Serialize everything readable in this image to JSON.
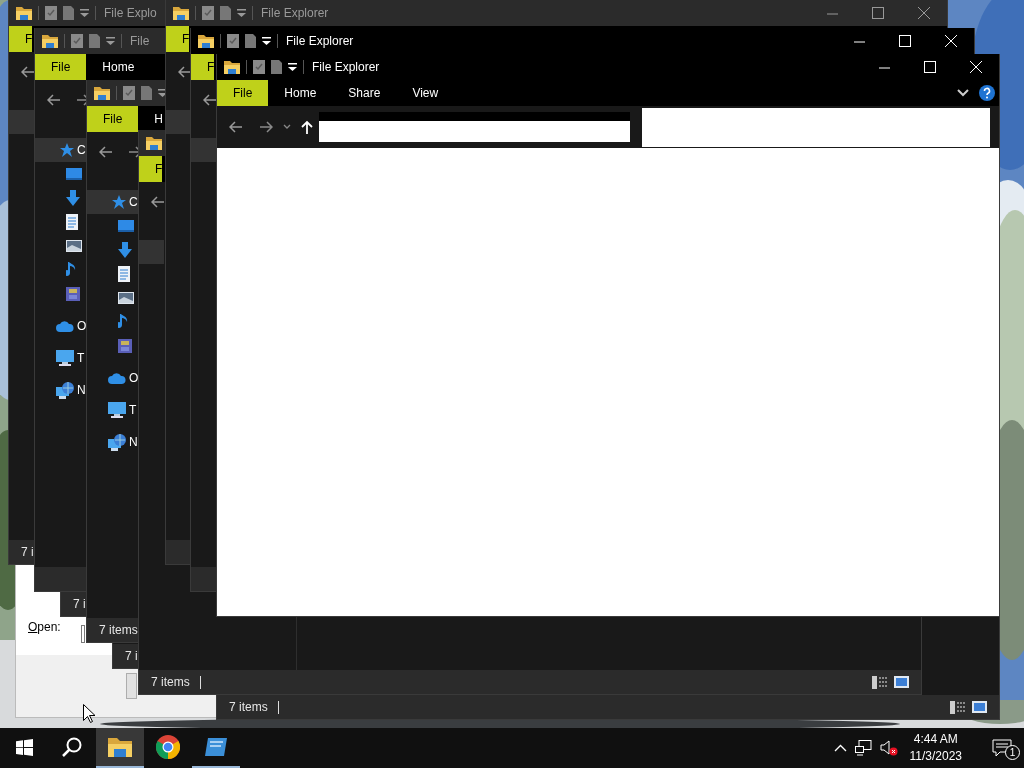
{
  "run_dialog": {
    "label": "Open:"
  },
  "windows": [
    {
      "kind": "explorer",
      "titlebar": {
        "title": "File Explo",
        "active": false
      },
      "ribbon_tabs": [
        {
          "label": "F",
          "selected": true
        }
      ],
      "nav": true,
      "sidebar": [
        {
          "kind": "quick",
          "selected": true
        }
      ],
      "status": "7 i"
    },
    {
      "kind": "explorer",
      "titlebar": {
        "title": "File",
        "active": false
      },
      "ribbon_tabs": [
        {
          "label": "File",
          "selected": true
        },
        {
          "label": "Home",
          "selected": false
        }
      ],
      "nav": true,
      "sidebar": [
        {
          "kind": "quick",
          "label": "C",
          "selected": true
        },
        {
          "kind": "desktop",
          "selected": false
        },
        {
          "kind": "downloads",
          "selected": false
        },
        {
          "kind": "documents",
          "selected": false
        },
        {
          "kind": "pictures",
          "selected": false
        },
        {
          "kind": "music",
          "selected": false
        },
        {
          "kind": "videos",
          "selected": false
        },
        {
          "kind": "cloud",
          "label": "O",
          "selected": false
        },
        {
          "kind": "pc",
          "label": "T",
          "selected": false
        },
        {
          "kind": "network",
          "label": "N",
          "selected": false
        }
      ]
    },
    {
      "kind": "explorer",
      "status": "7 i"
    },
    {
      "kind": "explorer",
      "titlebar": {
        "active": false
      },
      "ribbon_tabs": [
        {
          "label": "File",
          "selected": true
        },
        {
          "label": "H",
          "selected": false
        }
      ],
      "nav": true,
      "sidebar": [
        {
          "kind": "quick",
          "label": "C",
          "selected": true
        },
        {
          "kind": "desktop",
          "selected": false
        },
        {
          "kind": "downloads",
          "selected": false
        },
        {
          "kind": "documents",
          "selected": false
        },
        {
          "kind": "pictures",
          "selected": false
        },
        {
          "kind": "music",
          "selected": false
        },
        {
          "kind": "videos",
          "selected": false
        },
        {
          "kind": "cloud",
          "label": "O",
          "selected": false
        },
        {
          "kind": "pc",
          "label": "T",
          "selected": false
        },
        {
          "kind": "network",
          "label": "N",
          "selected": false
        }
      ],
      "status": "7 items"
    },
    {
      "kind": "explorer",
      "status": "7 i"
    },
    {
      "kind": "explorer",
      "status": "7 items",
      "view_buttons": true
    },
    {
      "kind": "explorer",
      "titlebar": {
        "active": false
      },
      "ribbon_tabs": [
        {
          "label": "F",
          "selected": true
        }
      ],
      "nav": true,
      "sidebar": [
        {
          "kind": "quick",
          "selected": true
        }
      ],
      "status": "7 items",
      "view_buttons": true
    },
    {
      "kind": "explorer",
      "titlebar": {
        "title": "File Explorer",
        "active": false,
        "controls": true
      },
      "ribbon_tabs": [
        {
          "label": "F",
          "selected": true
        }
      ],
      "nav": true,
      "sidebar": [
        {
          "kind": "quick",
          "selected": true
        }
      ]
    },
    {
      "kind": "explorer",
      "titlebar": {
        "title": "File Explorer",
        "active": true,
        "controls": true
      },
      "ribbon_tabs": [
        {
          "label": "F",
          "selected": true
        }
      ],
      "nav": true,
      "sidebar": [
        {
          "kind": "quick",
          "selected": true
        }
      ]
    },
    {
      "kind": "front",
      "titlebar": {
        "title": "File Explorer",
        "active": true,
        "controls": true
      },
      "ribbon_tabs": [
        {
          "label": "File",
          "selected": true
        },
        {
          "label": "Home",
          "selected": false
        },
        {
          "label": "Share",
          "selected": false
        },
        {
          "label": "View",
          "selected": false
        }
      ],
      "nav": true
    }
  ],
  "taskbar": {
    "apps": [
      {
        "kind": "start"
      },
      {
        "kind": "search"
      },
      {
        "kind": "files",
        "selected": true,
        "running": true
      },
      {
        "kind": "browser",
        "selected": false,
        "running": false
      },
      {
        "kind": "app",
        "selected": false,
        "running": true
      }
    ],
    "time": "4:44 AM",
    "date": "11/3/2023",
    "notifications": "1"
  }
}
